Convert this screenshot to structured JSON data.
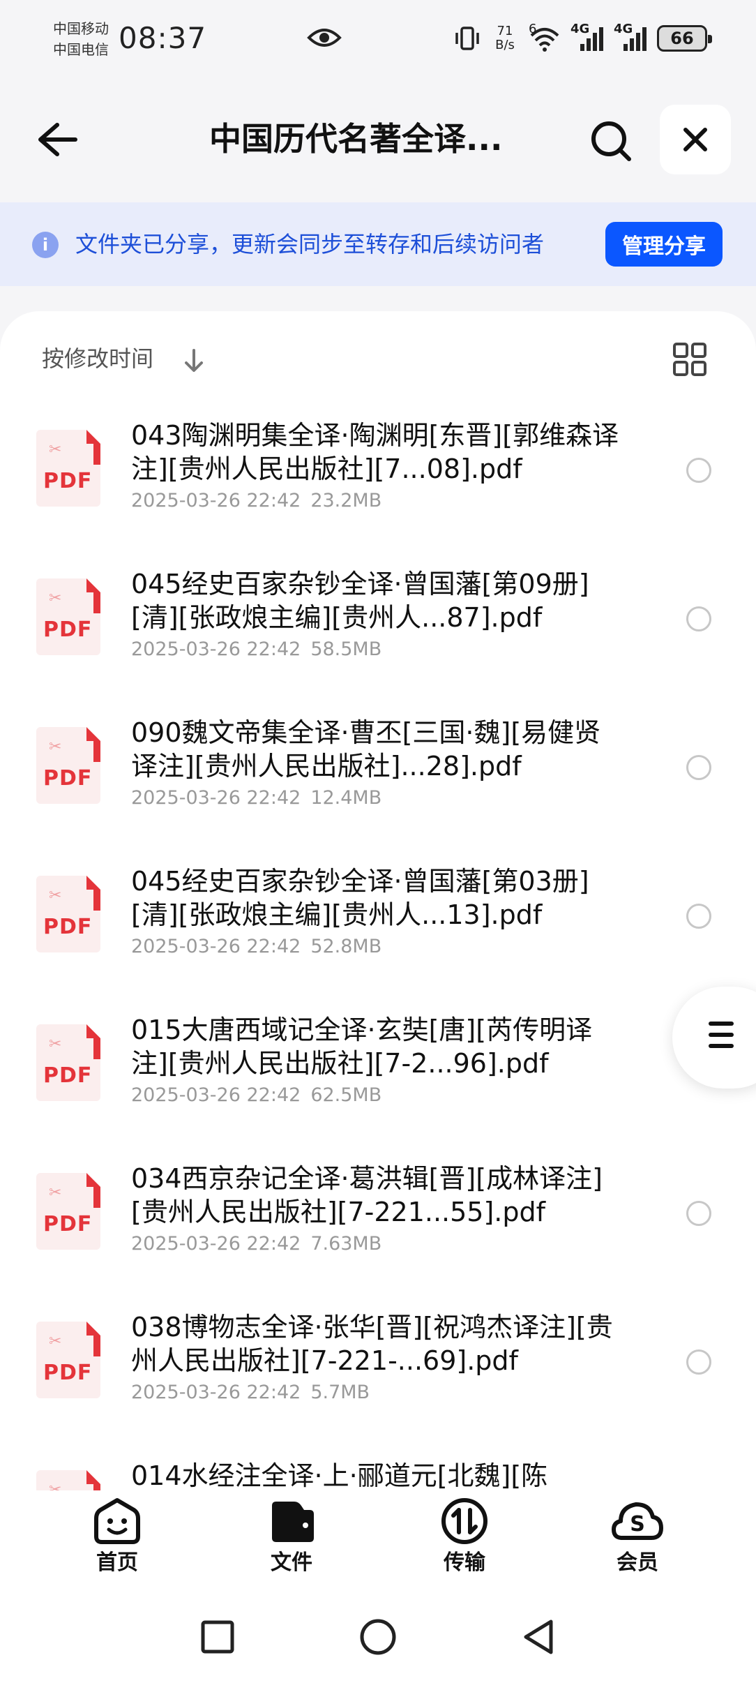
{
  "status_bar": {
    "carrier1": "中国移动",
    "carrier2": "中国电信",
    "time": "08:37",
    "net_speed_value": "71",
    "net_speed_unit": "B/s",
    "wifi_label": "6",
    "signal1_label": "4G",
    "signal2_label": "4G",
    "battery": "66"
  },
  "header": {
    "title": "中国历代名著全译..."
  },
  "banner": {
    "text": "文件夹已分享，更新会同步至转存和后续访问者",
    "button": "管理分享",
    "info_icon": "i"
  },
  "sort": {
    "label": "按修改时间"
  },
  "files": [
    {
      "name": "043陶渊明集全译·陶渊明[东晋][郭维森译注][贵州人民出版社][7...08].pdf",
      "date": "2025-03-26 22:42",
      "size": "23.2MB"
    },
    {
      "name": "045经史百家杂钞全译·曾国藩[第09册][清][张政烺主编][贵州人...87].pdf",
      "date": "2025-03-26 22:42",
      "size": "58.5MB"
    },
    {
      "name": "090魏文帝集全译·曹丕[三国·魏][易健贤译注][贵州人民出版社]...28].pdf",
      "date": "2025-03-26 22:42",
      "size": "12.4MB"
    },
    {
      "name": "045经史百家杂钞全译·曾国藩[第03册][清][张政烺主编][贵州人...13].pdf",
      "date": "2025-03-26 22:42",
      "size": "52.8MB"
    },
    {
      "name": "015大唐西域记全译·玄奘[唐][芮传明译注][贵州人民出版社][7-2...96].pdf",
      "date": "2025-03-26 22:42",
      "size": "62.5MB"
    },
    {
      "name": "034西京杂记全译·葛洪辑[晋][成林译注][贵州人民出版社][7-221...55].pdf",
      "date": "2025-03-26 22:42",
      "size": "7.63MB"
    },
    {
      "name": "038博物志全译·张华[晋][祝鸿杰译注][贵州人民出版社][7-221-...69].pdf",
      "date": "2025-03-26 22:42",
      "size": "5.7MB"
    },
    {
      "name": "014水经注全译·上·郦道元[北魏][陈",
      "date": "",
      "size": ""
    }
  ],
  "pdf_icon_text": "PDF",
  "tabs": [
    {
      "label": "首页",
      "icon": "home-face-icon"
    },
    {
      "label": "文件",
      "icon": "folder-icon"
    },
    {
      "label": "传输",
      "icon": "transfer-icon"
    },
    {
      "label": "会员",
      "icon": "vip-cloud-icon"
    }
  ],
  "vip_icon_glyph": "S",
  "colors": {
    "accent": "#0b57ff",
    "banner_bg": "#e8ecfb",
    "banner_text": "#1d4fd8",
    "pdf_red": "#e4343a"
  }
}
